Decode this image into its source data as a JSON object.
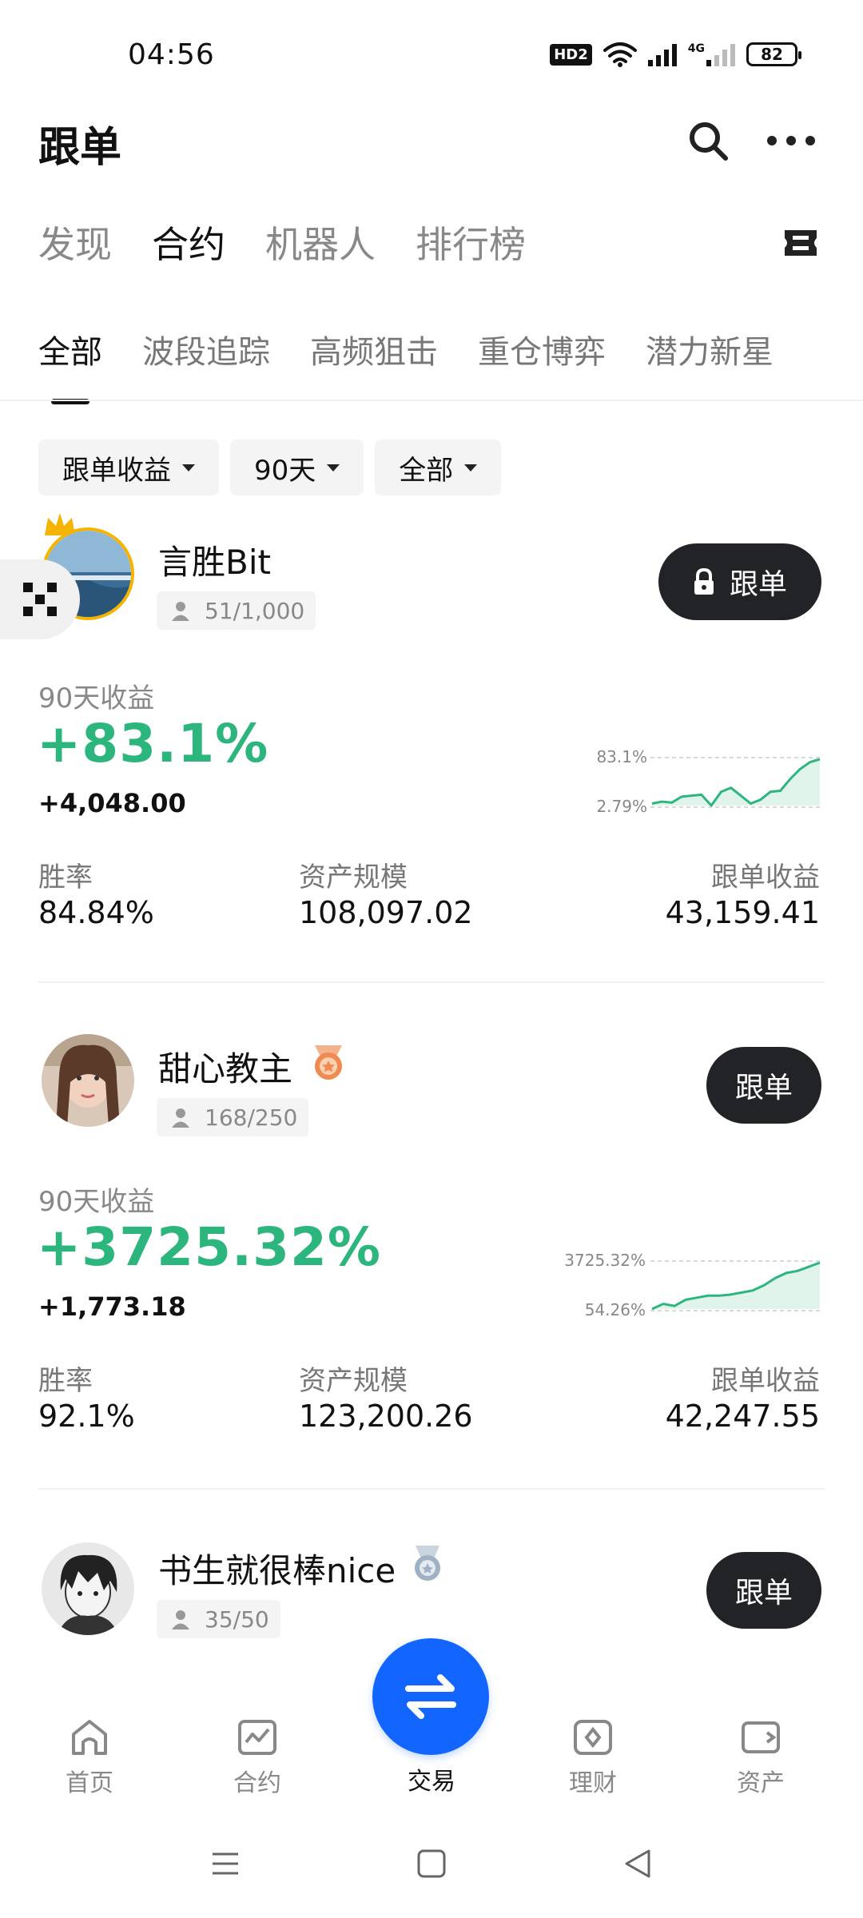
{
  "status_bar": {
    "time": "04:56",
    "hd": "HD2",
    "net_label": "4G",
    "battery": "82"
  },
  "header": {
    "title": "跟单"
  },
  "top_tabs": [
    "发现",
    "合约",
    "机器人",
    "排行榜"
  ],
  "top_tab_active": 1,
  "sub_tabs": [
    "全部",
    "波段追踪",
    "高频狙击",
    "重仓博弈",
    "潜力新星"
  ],
  "sub_tab_active": 0,
  "filters": [
    {
      "label": "跟单收益"
    },
    {
      "label": "90天"
    },
    {
      "label": "全部"
    }
  ],
  "traders": [
    {
      "name": "言胜Bit",
      "copiers": "51/1,000",
      "follow_label": "跟单",
      "locked": true,
      "roi_label": "90天收益",
      "roi": "+83.1%",
      "pnl": "+4,048.00",
      "spark_max": "83.1%",
      "spark_min": "2.79%",
      "spark": [
        10,
        12,
        11,
        17,
        18,
        19,
        8,
        22,
        26,
        18,
        10,
        14,
        22,
        23,
        35,
        45,
        52,
        55
      ],
      "stats": [
        {
          "label": "胜率",
          "value": "84.84%"
        },
        {
          "label": "资产规模",
          "value": "108,097.02"
        },
        {
          "label": "跟单收益",
          "value": "43,159.41"
        }
      ]
    },
    {
      "name": "甜心教主",
      "copiers": "168/250",
      "follow_label": "跟单",
      "locked": false,
      "roi_label": "90天收益",
      "roi": "+3725.32%",
      "pnl": "+1,773.18",
      "spark_max": "3725.32%",
      "spark_min": "54.26%",
      "spark": [
        5,
        10,
        8,
        14,
        16,
        18,
        18,
        19,
        21,
        23,
        28,
        35,
        40,
        42,
        46,
        50
      ],
      "stats": [
        {
          "label": "胜率",
          "value": "92.1%"
        },
        {
          "label": "资产规模",
          "value": "123,200.26"
        },
        {
          "label": "跟单收益",
          "value": "42,247.55"
        }
      ]
    },
    {
      "name": "书生就很棒nice",
      "copiers": "35/50",
      "follow_label": "跟单",
      "locked": false
    }
  ],
  "bottom_nav": [
    {
      "label": "首页",
      "icon": "home-icon"
    },
    {
      "label": "合约",
      "icon": "chart-icon"
    },
    {
      "label": "交易",
      "icon": "swap-icon"
    },
    {
      "label": "理财",
      "icon": "finance-icon"
    },
    {
      "label": "资产",
      "icon": "wallet-icon"
    }
  ],
  "colors": {
    "accent": "#2cb67d",
    "primary": "#1266ff",
    "button": "#222326"
  }
}
